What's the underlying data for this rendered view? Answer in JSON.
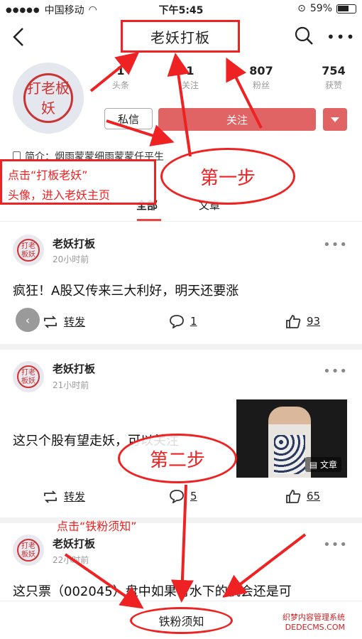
{
  "status": {
    "carrier": "中国移动",
    "time": "下午5:45",
    "battery": "59%"
  },
  "nav": {
    "title": "老妖打板"
  },
  "profile": {
    "avatar_text": "打老板妖",
    "stats": [
      {
        "value": "1",
        "label": "头条"
      },
      {
        "value": "1",
        "label": "关注"
      },
      {
        "value": "807",
        "label": "粉丝"
      },
      {
        "value": "754",
        "label": "获赞"
      }
    ],
    "message_label": "私信",
    "follow_label": "关注",
    "bio": "简介：烟雨蒙蒙细雨蒙蒙任平生"
  },
  "tabs": [
    {
      "label": "全部"
    },
    {
      "label": "文章"
    }
  ],
  "posts": [
    {
      "author": "老妖打板",
      "time": "20小时前",
      "text": "疯狂！A股又传来三大利好，明天还要涨",
      "repost_label": "转发",
      "comments": "1",
      "likes": "93"
    },
    {
      "author": "老妖打板",
      "time": "21小时前",
      "text": "这只个股有望走妖，可以关注",
      "thumb_badge": "文章",
      "repost_label": "转发",
      "comments": "5",
      "likes": "65"
    },
    {
      "author": "老妖打板",
      "time": "22小时前",
      "text": "这只票（002045）盘中如果有水下的机会还是可"
    }
  ],
  "bottom": {
    "fans_label": "铁粉须知"
  },
  "annotations": {
    "box_line1": "点击“打板老妖”",
    "box_line2": "头像，进入老妖主页",
    "step1": "第一步",
    "step2": "第二步",
    "step2_note": "点击“铁粉须知”",
    "watermark_line1": "织梦内容管理系统",
    "watermark_line2": "DEDECMS.COM"
  },
  "colors": {
    "accent": "#e06464",
    "annotation": "#e22222"
  }
}
